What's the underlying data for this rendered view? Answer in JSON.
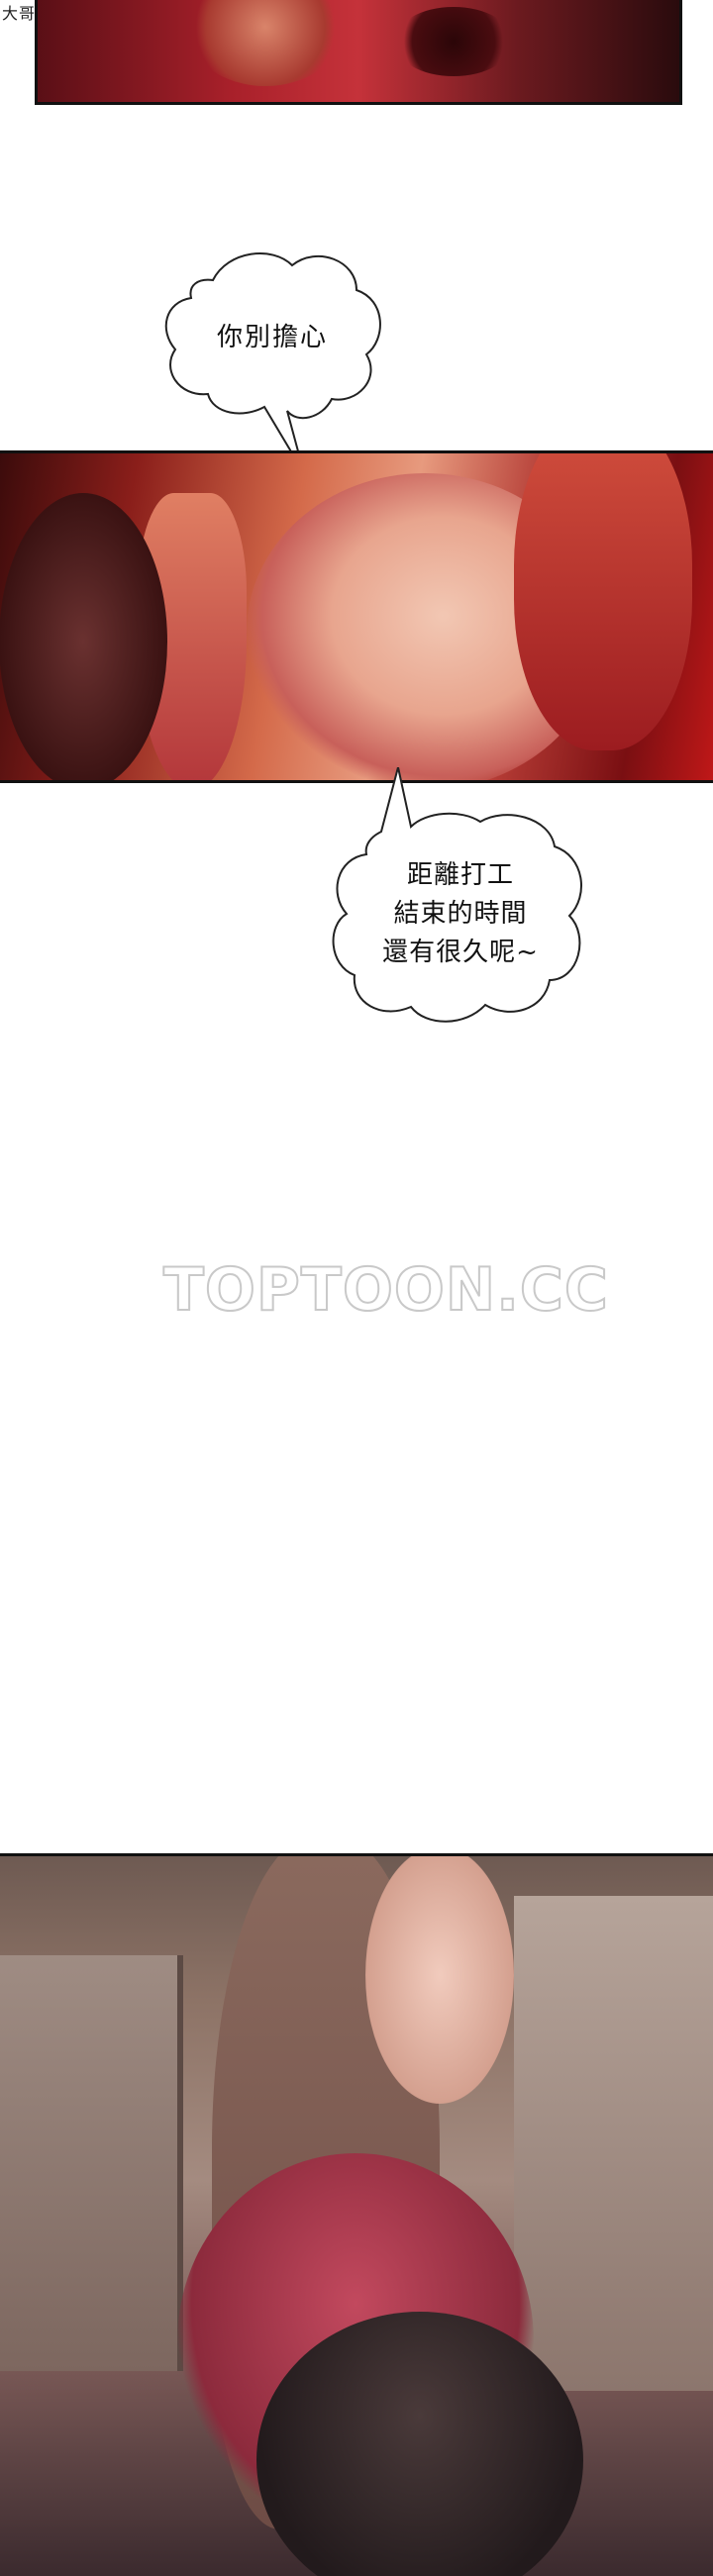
{
  "watermark_corner": "大哥整理",
  "bubble_top": {
    "text": "你別擔心"
  },
  "bubble_bottom": {
    "lines": [
      "距離打工",
      "結束的時間",
      "還有很久呢~"
    ]
  },
  "site_watermark": "TOPTOON.CC",
  "colors": {
    "panel_border": "#111111",
    "bubble_fill": "#ffffff",
    "bubble_stroke": "#222222"
  }
}
